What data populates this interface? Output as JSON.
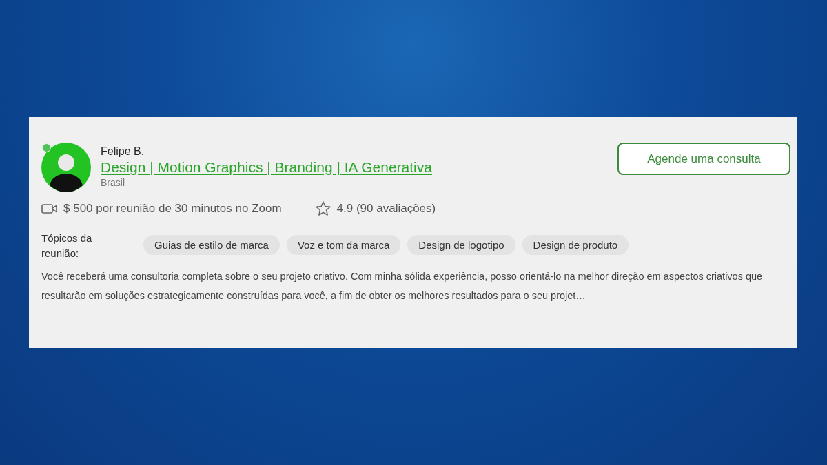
{
  "profile": {
    "name": "Felipe B.",
    "online": true,
    "headline": "Design | Motion Graphics | Branding | IA Generativa",
    "country": "Brasil"
  },
  "cta_button": "Agende uma consulta",
  "meeting": {
    "price": "$ 500 por reunião de 30 minutos no Zoom",
    "rating": "4.9 (90 avaliações)"
  },
  "topics": {
    "label": "Tópicos da reunião:",
    "tags": [
      "Guias de estilo de marca",
      "Voz e tom da marca",
      "Design de logotipo",
      "Design de produto"
    ]
  },
  "description": "Você receberá uma consultoria completa sobre o seu projeto criativo. Com minha sólida experiência, posso orientá-lo na melhor direção em aspectos criativos que resultarão em soluções estrategicamente construídas para você, a fim de obter os melhores resultados para o seu projet…"
}
